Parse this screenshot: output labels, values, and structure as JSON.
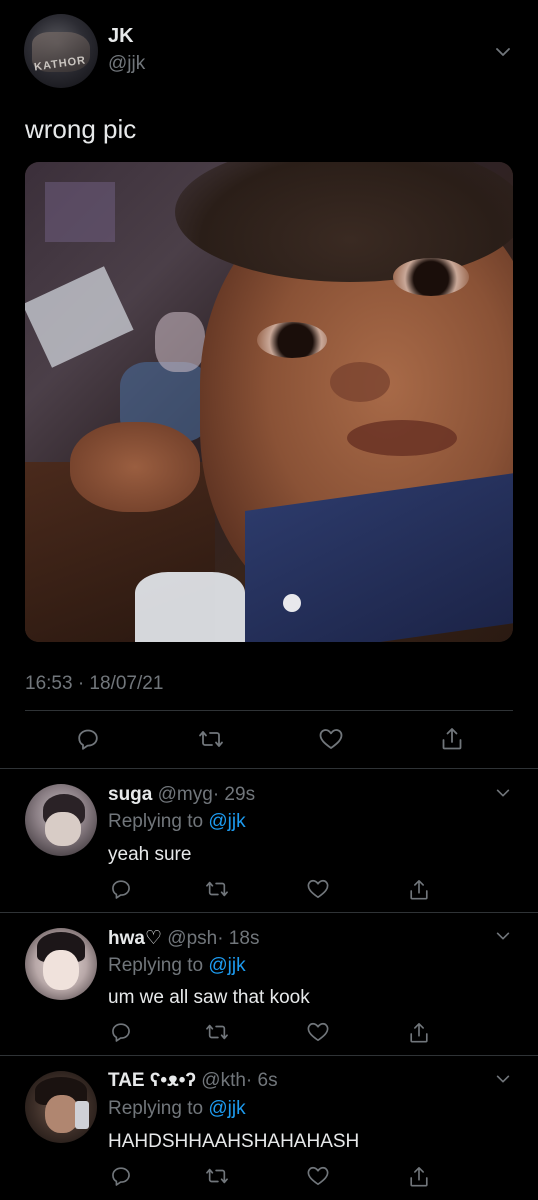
{
  "tweet": {
    "display_name": "JK",
    "handle": "@jjk",
    "text": "wrong pic",
    "timestamp": "16:53 · 18/07/21",
    "avatar_text": "KATHOR"
  },
  "replies": [
    {
      "display_name": "suga",
      "handle": "@myg",
      "time": "· 29s",
      "replying_prefix": "Replying to",
      "replying_handle": "@jjk",
      "text": "yeah sure"
    },
    {
      "display_name": "hwa♡",
      "handle": "@psh",
      "time": "· 18s",
      "replying_prefix": "Replying to",
      "replying_handle": "@jjk",
      "text": "um we all saw that kook"
    },
    {
      "display_name": "TAE ʕ•ᴥ•ʔ",
      "handle": "@kth",
      "time": "· 6s",
      "replying_prefix": "Replying to",
      "replying_handle": "@jjk",
      "text": "HAHDSHHAAHSHAHAHASH"
    }
  ],
  "icons": {
    "reply": "reply-icon",
    "retweet": "retweet-icon",
    "like": "heart-icon",
    "share": "share-icon",
    "more": "chevron-down-icon"
  },
  "colors": {
    "background": "#000000",
    "text": "#e7e9ea",
    "muted": "#71767b",
    "link": "#1d9bf0",
    "divider": "#2f3336"
  }
}
